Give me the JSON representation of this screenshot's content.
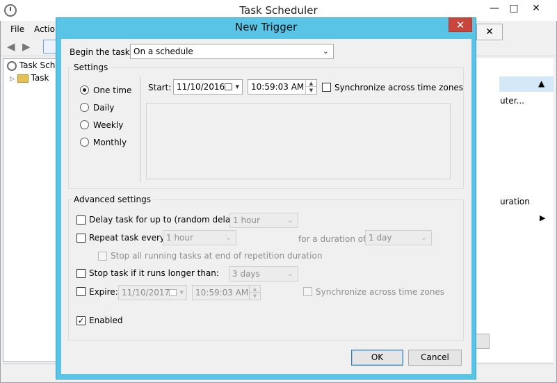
{
  "app": {
    "title": "Task Scheduler",
    "menu": [
      "File",
      "Actio"
    ],
    "tree": [
      "Task Sch",
      "Task"
    ],
    "right_pane": [
      "uter...",
      "uration"
    ],
    "inner_close": "✕",
    "controls": {
      "minimize": "—",
      "maximize": "□",
      "close": "✕"
    }
  },
  "dialog": {
    "title": "New Trigger",
    "close": "✕",
    "begin_task_label": "Begin the task:",
    "begin_task_value": "On a schedule",
    "settings": {
      "group_label": "Settings",
      "options": [
        "One time",
        "Daily",
        "Weekly",
        "Monthly"
      ],
      "selected_option": "One time",
      "start_label": "Start:",
      "start_date": "11/10/2016",
      "start_time": "10:59:03 AM",
      "sync_label": "Synchronize across time zones"
    },
    "advanced": {
      "group_label": "Advanced settings",
      "delay_label": "Delay task for up to (random delay):",
      "delay_value": "1 hour",
      "repeat_label": "Repeat task every:",
      "repeat_value": "1 hour",
      "duration_label": "for a duration of:",
      "duration_value": "1 day",
      "stop_running_label": "Stop all running tasks at end of repetition duration",
      "stop_longer_label": "Stop task if it runs longer than:",
      "stop_longer_value": "3 days",
      "expire_label": "Expire:",
      "expire_date": "11/10/2017",
      "expire_time": "10:59:03 AM",
      "expire_sync_label": "Synchronize across time zones",
      "enabled_label": "Enabled",
      "enabled_checked": true
    },
    "buttons": {
      "ok": "OK",
      "cancel": "Cancel"
    }
  }
}
